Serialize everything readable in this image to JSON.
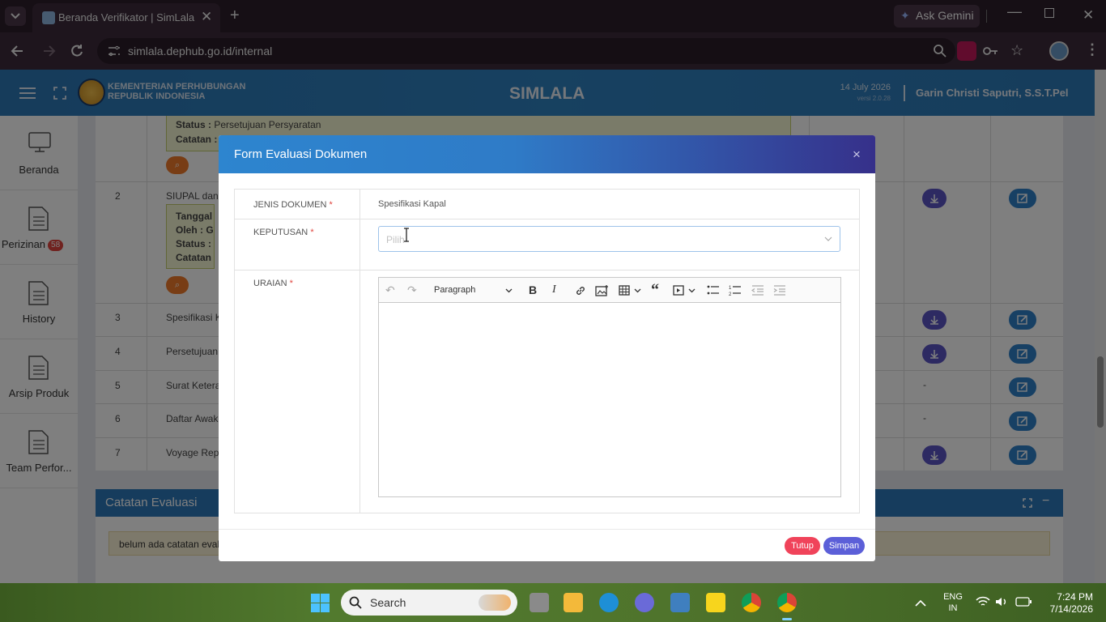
{
  "browser": {
    "tab_title": "Beranda Verifikator | SimLala",
    "url": "simlala.dephub.go.id/internal",
    "ask_gemini": "Ask Gemini"
  },
  "header": {
    "org_line1": "KEMENTERIAN PERHUBUNGAN",
    "org_line2": "REPUBLIK INDONESIA",
    "app_name": "SIMLALA",
    "date": "14 July 2026",
    "version": "versi 2.0.28",
    "user": "Garin Christi Saputri, S.S.T.Pel"
  },
  "sidebar": {
    "items": [
      {
        "label": "Beranda"
      },
      {
        "label": "Perizinan",
        "badge": "58"
      },
      {
        "label": "History"
      },
      {
        "label": "Arsip Produk"
      },
      {
        "label": "Team Perfor..."
      }
    ]
  },
  "background_table": {
    "row1": {
      "status_label": "Status :",
      "status_value": "Persetujuan Persyaratan",
      "catatan_label": "Catatan :"
    },
    "row2": {
      "no": "2",
      "name": "SIUPAL dan B",
      "tanggal": "Tanggal :",
      "oleh": "Oleh : Gar",
      "status": "Status : Pe",
      "catatan": "Catatan :"
    },
    "rows": [
      {
        "no": "3",
        "name": "Spesifikasi Ka",
        "dl": "yes",
        "extra": ""
      },
      {
        "no": "4",
        "name": "Persetujuan S",
        "dl": "yes",
        "extra": ""
      },
      {
        "no": "5",
        "name": "Surat Keteran",
        "dl": "no",
        "extra": "-"
      },
      {
        "no": "6",
        "name": "Daftar Awak K",
        "dl": "no",
        "extra": "-"
      },
      {
        "no": "7",
        "name": "Voyage Repor",
        "dl": "yes",
        "extra": ""
      }
    ]
  },
  "catatan": {
    "title": "Catatan Evaluasi",
    "empty_text": "belum ada catatan evalu"
  },
  "modal": {
    "title": "Form Evaluasi Dokumen",
    "close": "×",
    "jenis_label": "JENIS DOKUMEN",
    "jenis_value": "Spesifikasi Kapal",
    "keputusan_label": "KEPUTUSAN",
    "keputusan_placeholder": "Pilih",
    "uraian_label": "URAIAN",
    "required_mark": "*",
    "editor_paragraph": "Paragraph",
    "btn_tutup": "Tutup",
    "btn_simpan": "Simpan"
  },
  "taskbar": {
    "search": "Search",
    "lang1": "ENG",
    "lang2": "IN",
    "time": "7:24 PM",
    "date": "7/14/2026"
  },
  "colors": {
    "header_blue": "#2f82c1",
    "modal_gradient_end": "#36308a",
    "btn_tutup": "#f0435a",
    "btn_simpan": "#5c5fd8",
    "badge_red": "#e0443e",
    "search_orange": "#f07a2a"
  }
}
